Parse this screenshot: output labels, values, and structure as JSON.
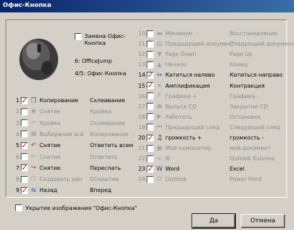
{
  "window": {
    "title": "Офис-Кнопка"
  },
  "top": {
    "replace_label": "Замена Офис-Кнопка",
    "replace_checked": false,
    "line6": "6: OfficeJump",
    "line45": "4/5: Офис-Кнопка"
  },
  "left_rows": [
    {
      "num": "1",
      "checked": true,
      "label": "Копирование",
      "label2": "Склеивание",
      "enabled": true,
      "icon": "copy-icon"
    },
    {
      "num": "2",
      "checked": false,
      "label": "Снятие",
      "label2": "Кройка",
      "enabled": false,
      "icon": "cut-icon"
    },
    {
      "num": "3",
      "checked": false,
      "label": "Кройка",
      "label2": "Склеивание",
      "enabled": false,
      "icon": "scissors-icon"
    },
    {
      "num": "4",
      "checked": false,
      "label": "Выбирание всё",
      "label2": "Копирование",
      "enabled": false,
      "icon": "select-all-icon"
    },
    {
      "num": "5",
      "checked": true,
      "label": "Снятие",
      "label2": "Ответить всем",
      "enabled": true,
      "icon": "reply-all-icon"
    },
    {
      "num": "6",
      "checked": false,
      "label": "Снятие",
      "label2": "Ответить",
      "enabled": false,
      "icon": "reply-icon"
    },
    {
      "num": "7",
      "checked": true,
      "label": "Снятие",
      "label2": "Переслать",
      "enabled": true,
      "icon": "forward-icon"
    },
    {
      "num": "8",
      "checked": false,
      "label": "Создавать ран",
      "label2": "Открытие",
      "enabled": false,
      "icon": "new-doc-icon"
    },
    {
      "num": "9",
      "checked": true,
      "label": "Назад",
      "label2": "Вперед",
      "enabled": true,
      "icon": "back-forward-icon"
    }
  ],
  "right_rows": [
    {
      "num": "10",
      "checked": false,
      "label": "Минимум",
      "label2": "Восстановление",
      "enabled": false,
      "icon": "minimize-icon"
    },
    {
      "num": "11",
      "checked": false,
      "label": "Предыдущий документ",
      "label2": "Следующий документ",
      "enabled": false,
      "icon": "prev-doc-icon"
    },
    {
      "num": "12",
      "checked": false,
      "label": "Page Down",
      "label2": "Page Up",
      "enabled": false,
      "icon": "page-down-icon"
    },
    {
      "num": "13",
      "checked": false,
      "label": "Начало",
      "label2": "Конец",
      "enabled": false,
      "icon": "home-icon"
    },
    {
      "num": "14",
      "checked": true,
      "label": "Катиться налево",
      "label2": "Катиться направо",
      "enabled": true,
      "icon": "scroll-horizontal-icon"
    },
    {
      "num": "15",
      "checked": true,
      "label": "Амплификация",
      "label2": "Контракция",
      "enabled": true,
      "icon": "zoom-icon"
    },
    {
      "num": "16",
      "checked": false,
      "label": "Графика +",
      "label2": "Графика -",
      "enabled": false,
      "icon": "font-icon"
    },
    {
      "num": "17",
      "checked": false,
      "label": "Выпуск CD",
      "label2": "Закрытие CD",
      "enabled": false,
      "icon": "eject-icon"
    },
    {
      "num": "18",
      "checked": false,
      "label": "Работать",
      "label2": "Остановка",
      "enabled": false,
      "icon": "play-pause-icon"
    },
    {
      "num": "19",
      "checked": false,
      "label": "Предыдущий след",
      "label2": "Следующий след",
      "enabled": false,
      "icon": "prev-track-icon"
    },
    {
      "num": "20",
      "checked": true,
      "label": "громкость +",
      "label2": "громкость -",
      "enabled": true,
      "icon": "volume-icon"
    },
    {
      "num": "21",
      "checked": false,
      "label": "Мой компьютер",
      "label2": "мой документ",
      "enabled": false,
      "icon": "computer-icon"
    },
    {
      "num": "22",
      "checked": false,
      "label": "IE",
      "label2": "Outlook Express",
      "enabled": false,
      "icon": "ie-icon"
    },
    {
      "num": "23",
      "checked": true,
      "label": "Word",
      "label2": "Excel",
      "enabled": true,
      "icon": "word-icon"
    },
    {
      "num": "24",
      "checked": false,
      "label": "Outlook",
      "label2": "Power Point",
      "enabled": false,
      "icon": "outlook-icon"
    }
  ],
  "bottom": {
    "hide_label": "Укрытие изображения \"Офис-Кнопка\"",
    "hide_checked": false,
    "ok": "Да",
    "cancel": "Отмена"
  }
}
